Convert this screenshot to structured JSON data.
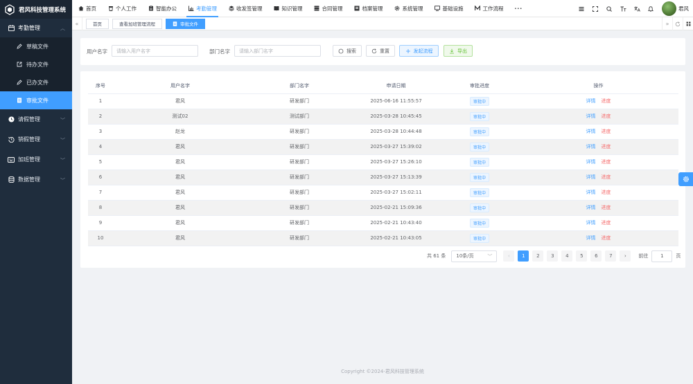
{
  "app": {
    "title": "君风科技管理系统"
  },
  "sidebar": {
    "group": {
      "label": "考勤管理",
      "icon": "calendar-icon"
    },
    "sub_items": [
      {
        "label": "草稿文件",
        "icon": "edit-icon"
      },
      {
        "label": "待办文件",
        "icon": "external-link-icon"
      },
      {
        "label": "已办文件",
        "icon": "edit-icon"
      },
      {
        "label": "审批文件",
        "icon": "document-icon",
        "active": true
      }
    ],
    "menus": [
      {
        "label": "请假管理",
        "icon": "clock-icon"
      },
      {
        "label": "销假管理",
        "icon": "history-icon"
      },
      {
        "label": "加班管理",
        "icon": "keyboard-icon"
      },
      {
        "label": "数据管理",
        "icon": "database-icon"
      }
    ]
  },
  "topnav": {
    "items": [
      {
        "label": "首页",
        "icon": "home-icon"
      },
      {
        "label": "个人工作",
        "icon": "trash-icon"
      },
      {
        "label": "智能办公",
        "icon": "clipboard-icon"
      },
      {
        "label": "考勤管理",
        "icon": "bar-chart-icon",
        "active": true
      },
      {
        "label": "收发签管理",
        "icon": "layers-icon"
      },
      {
        "label": "知识管理",
        "icon": "book-icon"
      },
      {
        "label": "合同管理",
        "icon": "stack-icon"
      },
      {
        "label": "档案管理",
        "icon": "archive-icon"
      },
      {
        "label": "系统管理",
        "icon": "gear-icon"
      },
      {
        "label": "基础设施",
        "icon": "monitor-icon"
      },
      {
        "label": "工作流程",
        "icon": "workflow-icon"
      }
    ],
    "more": "···",
    "user": "君风"
  },
  "tags": [
    {
      "label": "首页"
    },
    {
      "label": "查看加班管理流程"
    },
    {
      "label": "审批文件",
      "active": true
    }
  ],
  "search": {
    "username_label": "用户名字",
    "username_placeholder": "请输入用户名字",
    "dept_label": "部门名字",
    "dept_placeholder": "请输入部门名字",
    "search_btn": "搜索",
    "reset_btn": "重置",
    "start_btn": "发起流程",
    "export_btn": "导出"
  },
  "table": {
    "headers": [
      "序号",
      "用户名字",
      "部门名字",
      "申请日期",
      "审批进度",
      "操作"
    ],
    "detail_label": "详情",
    "progress_label": "进度",
    "rows": [
      {
        "no": "1",
        "user": "君风",
        "dept": "研发部门",
        "date": "2025-06-16 11:55:57",
        "status": "审批中"
      },
      {
        "no": "2",
        "user": "测试02",
        "dept": "测试部门",
        "date": "2025-03-28 10:45:45",
        "status": "审批中"
      },
      {
        "no": "3",
        "user": "赵龙",
        "dept": "研发部门",
        "date": "2025-03-28 10:44:48",
        "status": "审批中"
      },
      {
        "no": "4",
        "user": "君风",
        "dept": "研发部门",
        "date": "2025-03-27 15:39:02",
        "status": "审批中"
      },
      {
        "no": "5",
        "user": "君风",
        "dept": "研发部门",
        "date": "2025-03-27 15:26:10",
        "status": "审批中"
      },
      {
        "no": "6",
        "user": "君风",
        "dept": "研发部门",
        "date": "2025-03-27 15:13:39",
        "status": "审批中"
      },
      {
        "no": "7",
        "user": "君风",
        "dept": "研发部门",
        "date": "2025-03-27 15:02:11",
        "status": "审批中"
      },
      {
        "no": "8",
        "user": "君风",
        "dept": "研发部门",
        "date": "2025-02-21 15:09:36",
        "status": "审批中"
      },
      {
        "no": "9",
        "user": "君风",
        "dept": "研发部门",
        "date": "2025-02-21 10:43:40",
        "status": "审批中"
      },
      {
        "no": "10",
        "user": "君风",
        "dept": "研发部门",
        "date": "2025-02-21 10:43:05",
        "status": "审批中"
      }
    ]
  },
  "pagination": {
    "total": "共 61 条",
    "page_size": "10条/页",
    "pages": [
      "1",
      "2",
      "3",
      "4",
      "5",
      "6",
      "7"
    ],
    "current": "1",
    "goto_label": "前往",
    "goto_value": "1",
    "page_unit": "页"
  },
  "footer": {
    "copyright": "Copyright ©2024-君风科技管理系统"
  },
  "colors": {
    "primary": "#409eff",
    "sidebar": "#1f2d3d",
    "danger": "#f56c6c",
    "success": "#67c23a"
  }
}
